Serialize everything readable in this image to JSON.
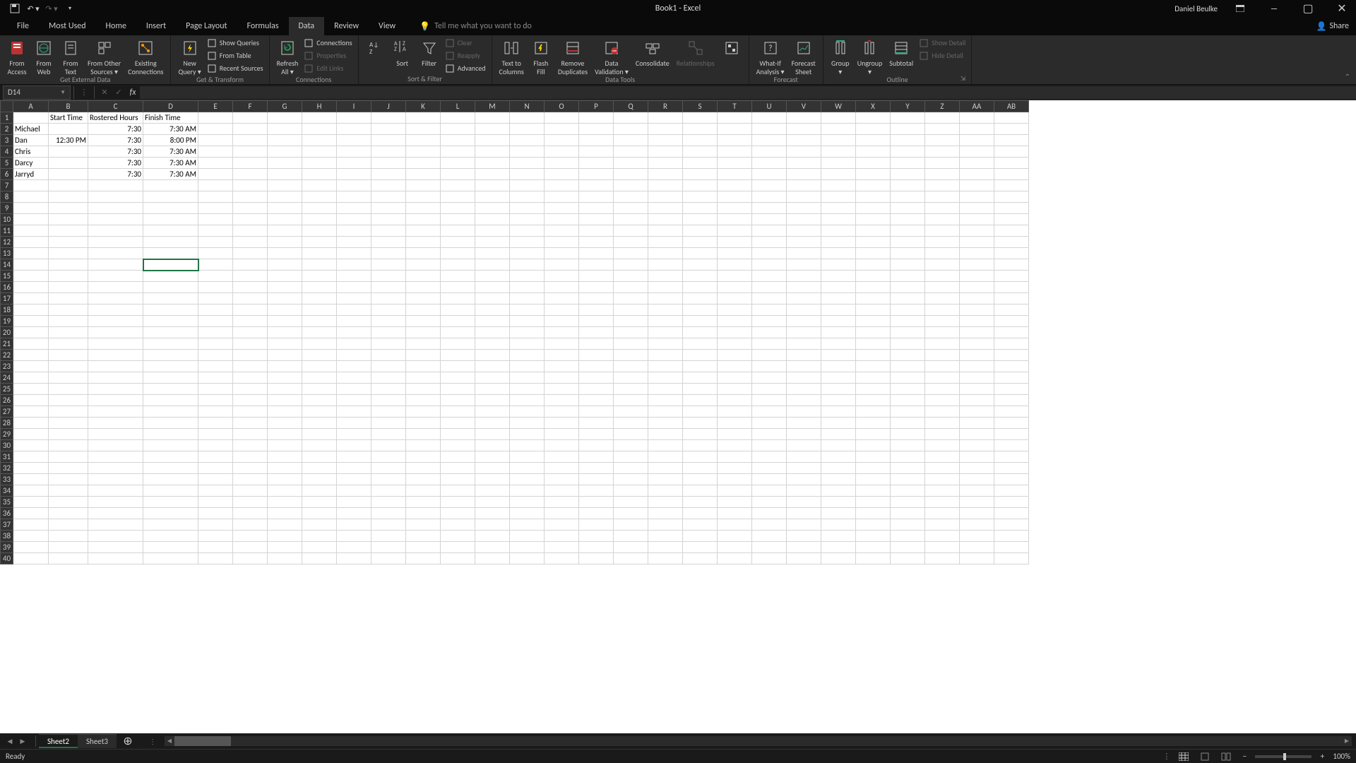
{
  "title": "Book1 - Excel",
  "username": "Daniel Beulke",
  "qat": {
    "save": "save",
    "undo": "undo",
    "redo": "redo"
  },
  "tabs": [
    "File",
    "Most Used",
    "Home",
    "Insert",
    "Page Layout",
    "Formulas",
    "Data",
    "Review",
    "View"
  ],
  "active_tab": "Data",
  "tellme": "Tell me what you want to do",
  "share": "Share",
  "ribbon": {
    "groups": [
      {
        "label": "Get External Data",
        "big": [
          {
            "name": "from-access",
            "line1": "From",
            "line2": "Access",
            "icon": "db-red"
          },
          {
            "name": "from-web",
            "line1": "From",
            "line2": "Web",
            "icon": "globe"
          },
          {
            "name": "from-text",
            "line1": "From",
            "line2": "Text",
            "icon": "text"
          },
          {
            "name": "from-other",
            "line1": "From Other",
            "line2": "Sources ▾",
            "icon": "other"
          },
          {
            "name": "existing-conn",
            "line1": "Existing",
            "line2": "Connections",
            "icon": "conn"
          }
        ],
        "small": []
      },
      {
        "label": "Get & Transform",
        "big": [
          {
            "name": "new-query",
            "line1": "New",
            "line2": "Query ▾",
            "icon": "bolt"
          }
        ],
        "small": [
          {
            "name": "show-queries",
            "label": "Show Queries",
            "icon": "table"
          },
          {
            "name": "from-table",
            "label": "From Table",
            "icon": "table"
          },
          {
            "name": "recent-sources",
            "label": "Recent Sources",
            "icon": "recent"
          }
        ]
      },
      {
        "label": "Connections",
        "big": [
          {
            "name": "refresh-all",
            "line1": "Refresh",
            "line2": "All ▾",
            "icon": "refresh"
          }
        ],
        "small": [
          {
            "name": "connections",
            "label": "Connections",
            "icon": "link"
          },
          {
            "name": "properties",
            "label": "Properties",
            "icon": "props",
            "disabled": true
          },
          {
            "name": "edit-links",
            "label": "Edit Links",
            "icon": "edit",
            "disabled": true
          }
        ]
      },
      {
        "label": "Sort & Filter",
        "big": [
          {
            "name": "sort-az",
            "line1": "",
            "line2": "",
            "icon": "az"
          },
          {
            "name": "sort",
            "line1": "Sort",
            "line2": "",
            "icon": "sort"
          },
          {
            "name": "filter",
            "line1": "Filter",
            "line2": "",
            "icon": "funnel"
          }
        ],
        "small": [
          {
            "name": "clear",
            "label": "Clear",
            "icon": "clear",
            "disabled": true
          },
          {
            "name": "reapply",
            "label": "Reapply",
            "icon": "reapply",
            "disabled": true
          },
          {
            "name": "advanced",
            "label": "Advanced",
            "icon": "funnel-adv"
          }
        ]
      },
      {
        "label": "Data Tools",
        "big": [
          {
            "name": "text-to-cols",
            "line1": "Text to",
            "line2": "Columns",
            "icon": "ttc"
          },
          {
            "name": "flash-fill",
            "line1": "Flash",
            "line2": "Fill",
            "icon": "ff"
          },
          {
            "name": "remove-dup",
            "line1": "Remove",
            "line2": "Duplicates",
            "icon": "dup"
          },
          {
            "name": "data-valid",
            "line1": "Data",
            "line2": "Validation ▾",
            "icon": "dv"
          },
          {
            "name": "consolidate",
            "line1": "Consolidate",
            "line2": "",
            "icon": "cons"
          },
          {
            "name": "relationships",
            "line1": "Relationships",
            "line2": "",
            "icon": "rel",
            "disabled": true
          },
          {
            "name": "manage-dm",
            "line1": "",
            "line2": "",
            "icon": "dm"
          }
        ],
        "small": []
      },
      {
        "label": "Forecast",
        "big": [
          {
            "name": "what-if",
            "line1": "What-If",
            "line2": "Analysis ▾",
            "icon": "wif"
          },
          {
            "name": "forecast-sheet",
            "line1": "Forecast",
            "line2": "Sheet",
            "icon": "fs"
          }
        ],
        "small": []
      },
      {
        "label": "Outline",
        "big": [
          {
            "name": "group",
            "line1": "Group",
            "line2": "▾",
            "icon": "grp"
          },
          {
            "name": "ungroup",
            "line1": "Ungroup",
            "line2": "▾",
            "icon": "ugrp"
          },
          {
            "name": "subtotal",
            "line1": "Subtotal",
            "line2": "",
            "icon": "sub"
          }
        ],
        "small": [
          {
            "name": "show-detail",
            "label": "Show Detail",
            "icon": "sd",
            "disabled": true
          },
          {
            "name": "hide-detail",
            "label": "Hide Detail",
            "icon": "hd",
            "disabled": true
          }
        ],
        "launcher": true
      }
    ]
  },
  "namebox": "D14",
  "formula": "",
  "columns": [
    "A",
    "B",
    "C",
    "D",
    "E",
    "F",
    "G",
    "H",
    "I",
    "J",
    "K",
    "L",
    "M",
    "N",
    "O",
    "P",
    "Q",
    "R",
    "S",
    "T",
    "U",
    "V",
    "W",
    "X",
    "Y",
    "Z",
    "AA",
    "AB"
  ],
  "row_count": 40,
  "selected": {
    "col": 3,
    "row": 13
  },
  "cells": {
    "B1": {
      "v": "Start Time",
      "align": "left"
    },
    "C1": {
      "v": "Rostered Hours",
      "align": "left"
    },
    "D1": {
      "v": "Finish Time",
      "align": "left"
    },
    "A2": {
      "v": "Michael",
      "align": "left"
    },
    "C2": {
      "v": "7:30",
      "align": "right"
    },
    "D2": {
      "v": "7:30 AM",
      "align": "right"
    },
    "A3": {
      "v": "Dan",
      "align": "left"
    },
    "B3": {
      "v": "12:30 PM",
      "align": "right"
    },
    "C3": {
      "v": "7:30",
      "align": "right"
    },
    "D3": {
      "v": "8:00 PM",
      "align": "right"
    },
    "A4": {
      "v": "Chris",
      "align": "left"
    },
    "C4": {
      "v": "7:30",
      "align": "right"
    },
    "D4": {
      "v": "7:30 AM",
      "align": "right"
    },
    "A5": {
      "v": "Darcy",
      "align": "left"
    },
    "C5": {
      "v": "7:30",
      "align": "right"
    },
    "D5": {
      "v": "7:30 AM",
      "align": "right"
    },
    "A6": {
      "v": "Jarryd",
      "align": "left"
    },
    "C6": {
      "v": "7:30",
      "align": "right"
    },
    "D6": {
      "v": "7:30 AM",
      "align": "right"
    }
  },
  "sheets": [
    "Sheet2",
    "Sheet3"
  ],
  "active_sheet": "Sheet2",
  "status": "Ready",
  "zoom": "100%"
}
